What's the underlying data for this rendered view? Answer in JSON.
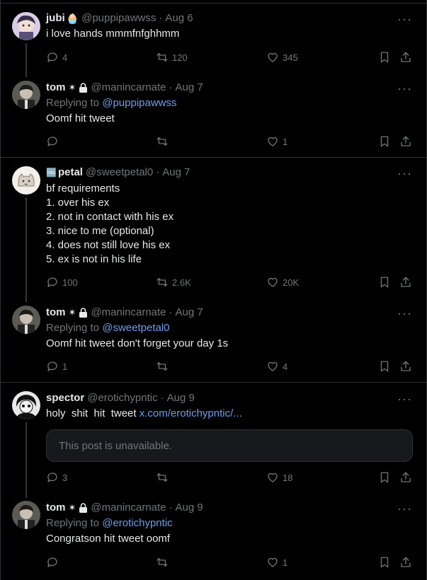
{
  "tweets": [
    {
      "name": "jubi",
      "emoji": "🧁",
      "handle": "@puppipawwss",
      "date": "Aug 6",
      "text": "i love hands mmmfnfghhmm",
      "reply": "4",
      "retweet": "120",
      "like": "345"
    },
    {
      "name": "tom",
      "badges": "✶",
      "handle": "@manincarnate",
      "date": "Aug 7",
      "replying_label": "Replying to",
      "replying_to": "@puppipawwss",
      "text": "Oomf hit tweet",
      "reply": "",
      "retweet": "",
      "like": "1"
    },
    {
      "name": "petal",
      "prefix": "🆒",
      "handle": "@sweetpetal0",
      "date": "Aug 7",
      "text": "bf requirements\n1. over his ex\n2. not in contact with his ex\n3. nice to me (optional)\n4. does not still love his ex\n5. ex is not in his life",
      "reply": "100",
      "retweet": "2.6K",
      "like": "20K"
    },
    {
      "name": "tom",
      "badges": "✶",
      "handle": "@manincarnate",
      "date": "Aug 7",
      "replying_label": "Replying to",
      "replying_to": "@sweetpetal0",
      "text": "Oomf hit tweet don't forget your day 1s",
      "reply": "1",
      "retweet": "",
      "like": "4"
    },
    {
      "name": "spector",
      "handle": "@erotichypntic",
      "date": "Aug 9",
      "text": "holy  shit  hit  tweet ",
      "link": "x.com/erotichypntic/...",
      "unavailable": "This post is unavailable.",
      "reply": "3",
      "retweet": "",
      "like": "18"
    },
    {
      "name": "tom",
      "badges": "✶",
      "handle": "@manincarnate",
      "date": "Aug 9",
      "replying_label": "Replying to",
      "replying_to": "@erotichypntic",
      "text": "Congratson hit tweet oomf",
      "reply": "",
      "retweet": "",
      "like": "1"
    }
  ],
  "more_label": "···",
  "colors": {
    "background": "#000000",
    "text": "#e7e9ea",
    "muted": "#71767b",
    "link": "#6d9eeb",
    "border": "#2f3336"
  }
}
